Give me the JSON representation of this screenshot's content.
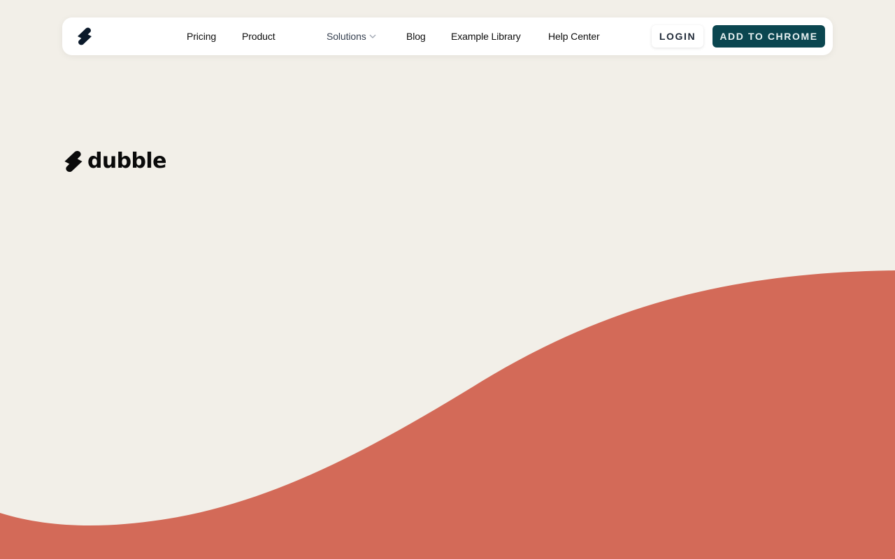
{
  "colors": {
    "background": "#f2efe8",
    "wave": "#d36a58",
    "primary_button": "#0b4650",
    "nav_bg": "#ffffff"
  },
  "nav": {
    "logo_icon": "dubble-logo-icon",
    "links": [
      {
        "label": "Pricing"
      },
      {
        "label": "Product"
      },
      {
        "label": "Solutions",
        "icon": "chevron-down-icon"
      },
      {
        "label": "Blog"
      },
      {
        "label": "Example Library"
      },
      {
        "label": "Help Center"
      }
    ],
    "login_label": "LOGIN",
    "cta_label": "ADD TO CHROME"
  },
  "hero": {
    "brand_name": "dubble",
    "logo_icon": "dubble-logo-icon"
  }
}
